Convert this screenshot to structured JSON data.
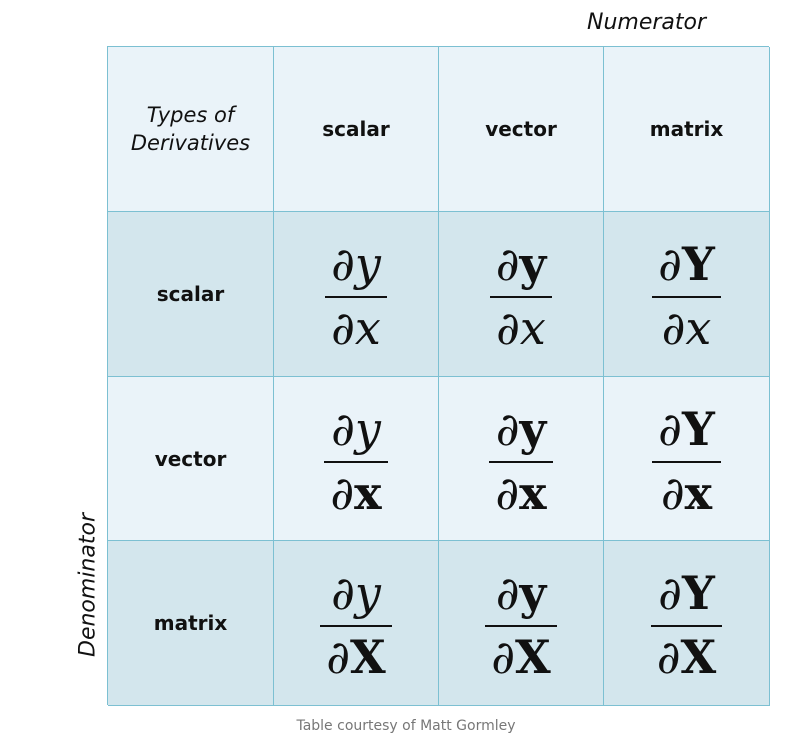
{
  "axis_labels": {
    "numerator": "Numerator",
    "denominator": "Denominator"
  },
  "corner": {
    "line1": "Types of",
    "line2": "Derivatives"
  },
  "column_headers": [
    "scalar",
    "vector",
    "matrix"
  ],
  "row_headers": [
    "scalar",
    "vector",
    "matrix"
  ],
  "partial_symbol": "∂",
  "cells": [
    [
      {
        "num": "y",
        "den": "x"
      },
      {
        "num": "y",
        "den": "x"
      },
      {
        "num": "Y",
        "den": "x"
      }
    ],
    [
      {
        "num": "y",
        "den": "x"
      },
      {
        "num": "y",
        "den": "x"
      },
      {
        "num": "Y",
        "den": "x"
      }
    ],
    [
      {
        "num": "y",
        "den": "X"
      },
      {
        "num": "y",
        "den": "X"
      },
      {
        "num": "Y",
        "den": "X"
      }
    ]
  ],
  "credit": "Table courtesy of Matt Gormley",
  "colors": {
    "light_cell": "#eaf3f9",
    "dark_cell": "#d3e6ed",
    "border": "#7cc0d2"
  }
}
